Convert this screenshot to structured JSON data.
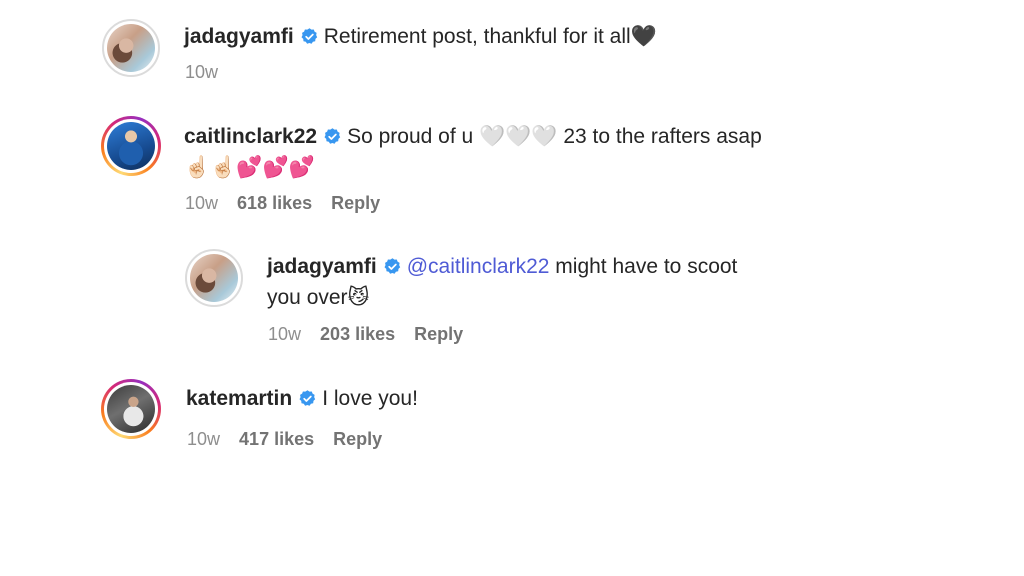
{
  "comments": [
    {
      "username": "jadagyamfi",
      "text": "Retirement post, thankful for it all",
      "emoji": "🖤",
      "time": "10w"
    },
    {
      "username": "caitlinclark22",
      "text": "So proud of u",
      "hearts": "🤍🤍🤍",
      "text_after": "23 to the rafters asap",
      "emoji_line": "☝🏻☝🏻💕💕💕",
      "time": "10w",
      "likes": "618 likes",
      "reply_label": "Reply"
    },
    {
      "username": "jadagyamfi",
      "mention": "@caitlinclark22",
      "text": "might have to scoot",
      "text_line2": "you over",
      "emoji": "😼",
      "time": "10w",
      "likes": "203 likes",
      "reply_label": "Reply"
    },
    {
      "username": "katemartin",
      "text": "I love you!",
      "time": "10w",
      "likes": "417 likes",
      "reply_label": "Reply"
    }
  ],
  "colors": {
    "verified": "#3897f0",
    "mention": "#4f5bd5",
    "meta": "#8e8e8e"
  },
  "icons": {
    "verified": "verified-badge-icon"
  }
}
